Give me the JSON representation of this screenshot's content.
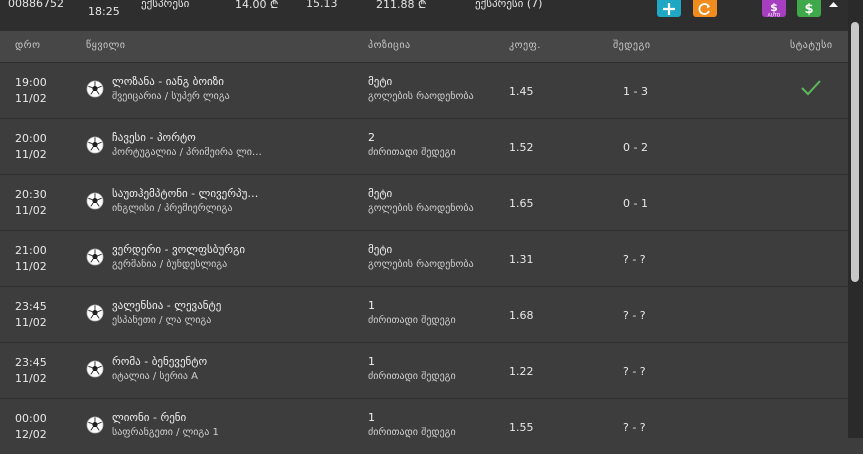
{
  "topbar": {
    "id": "00886752",
    "time": "18:25",
    "type": "ექსპრესი",
    "stake": "14.00 ₾",
    "total_odds": "15.13",
    "possible_win": "211.88 ₾",
    "status": "ექსპრესი (7)"
  },
  "columns": {
    "time": "დრო",
    "event": "წყვილი",
    "position": "პოზიცია",
    "odds": "კოეფ.",
    "result": "შედეგი",
    "status": "სტატუსი"
  },
  "colors": {
    "add": "#1fa8c4",
    "refresh": "#f08c1e",
    "auto": "#a63fbf",
    "cash": "#3fa84a",
    "check": "#5cb85c"
  },
  "rows": [
    {
      "time": "19:00",
      "date": "11/02",
      "event": "ლოზანა - იანგ ბოიზი",
      "league": "შვეიცარია / სუპერ ლიგა",
      "position": "მეტი",
      "market": "გოლების რაოდენობა",
      "odds": "1.45",
      "result": "1 - 3",
      "won": true
    },
    {
      "time": "20:00",
      "date": "11/02",
      "event": "ჩავესი - პორტო",
      "league": "პორტუგალია / პრიმეირა ლიგა",
      "position": "2",
      "market": "ძირითადი შედეგი",
      "odds": "1.52",
      "result": "0 - 2",
      "won": false
    },
    {
      "time": "20:30",
      "date": "11/02",
      "event": "საუთჰემპტონი - ლივერპული",
      "league": "ინგლისი / პრემიერლიგა",
      "position": "მეტი",
      "market": "გოლების რაოდენობა",
      "odds": "1.65",
      "result": "0 - 1",
      "won": false
    },
    {
      "time": "21:00",
      "date": "11/02",
      "event": "ვერდერი - ვოლფსბურგი",
      "league": "გერმანია / ბუნდესლიგა",
      "position": "მეტი",
      "market": "გოლების რაოდენობა",
      "odds": "1.31",
      "result": "? - ?",
      "won": false
    },
    {
      "time": "23:45",
      "date": "11/02",
      "event": "ვალენსია - ლევანტე",
      "league": "ესპანეთი / ლა ლიგა",
      "position": "1",
      "market": "ძირითადი შედეგი",
      "odds": "1.68",
      "result": "? - ?",
      "won": false
    },
    {
      "time": "23:45",
      "date": "11/02",
      "event": "რომა - ბენევენტო",
      "league": "იტალია / სერია A",
      "position": "1",
      "market": "ძირითადი შედეგი",
      "odds": "1.22",
      "result": "? - ?",
      "won": false
    },
    {
      "time": "00:00",
      "date": "12/02",
      "event": "ლიონი - რენი",
      "league": "საფრანგეთი / ლიგა 1",
      "position": "1",
      "market": "ძირითადი შედეგი",
      "odds": "1.55",
      "result": "? - ?",
      "won": false
    }
  ]
}
